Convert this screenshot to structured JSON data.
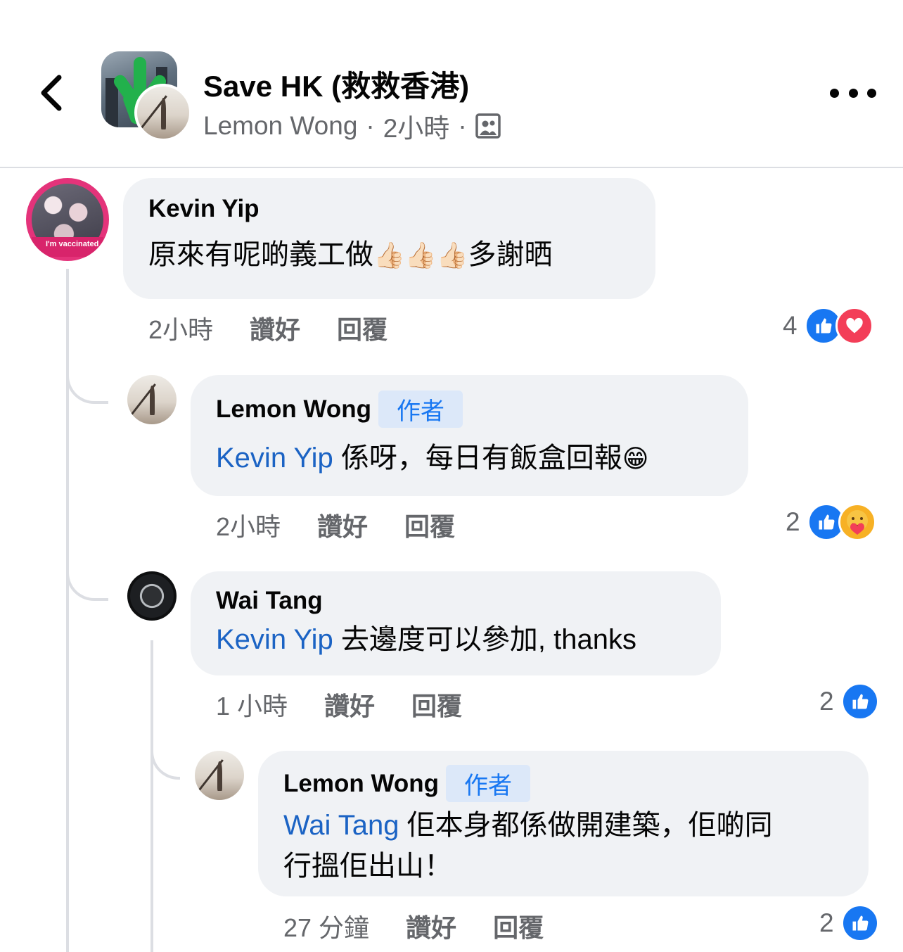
{
  "header": {
    "group_name": "Save HK (救救香港)",
    "author": "Lemon Wong",
    "time": "2小時",
    "separator": "·",
    "audience_icon": "group-audience-icon",
    "more_icon": "more-options-icon",
    "back_icon": "chevron-left-icon"
  },
  "comments": [
    {
      "name": "Kevin Yip",
      "text_before": "原來有呢啲義工做",
      "emoji": "👍🏻👍🏻👍🏻",
      "text_after": "多謝晒",
      "time": "2小時",
      "like_label": "讚好",
      "reply_label": "回覆",
      "reaction_count": "4",
      "reactions": [
        "like",
        "love"
      ]
    },
    {
      "name": "Lemon Wong",
      "badge": "作者",
      "mention": "Kevin Yip",
      "text": " 係呀，每日有飯盒回報",
      "emoji": "😁",
      "time": "2小時",
      "like_label": "讚好",
      "reply_label": "回覆",
      "reaction_count": "2",
      "reactions": [
        "like",
        "care"
      ]
    },
    {
      "name": "Wai Tang",
      "mention": "Kevin Yip",
      "text": " 去邊度可以參加, thanks",
      "time": "1 小時",
      "like_label": "讚好",
      "reply_label": "回覆",
      "reaction_count": "2",
      "reactions": [
        "like"
      ]
    },
    {
      "name": "Lemon Wong",
      "badge": "作者",
      "mention": "Wai Tang",
      "text_line1": " 佢本身都係做開建築，佢啲同",
      "text_line2": "行搵佢出山！",
      "time": "27 分鐘",
      "like_label": "讚好",
      "reply_label": "回覆",
      "reaction_count": "2",
      "reactions": [
        "like"
      ]
    }
  ],
  "kevin_avatar_ribbon": "I'm vaccinated",
  "colors": {
    "link": "#1b63c4",
    "like": "#1877f2",
    "love": "#f33e58",
    "meta": "#65676b",
    "bubble": "#f0f2f5"
  }
}
